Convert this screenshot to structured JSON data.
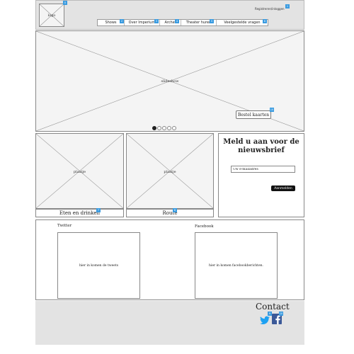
{
  "header": {
    "logo_label": "logo",
    "register_login": "Registreren/inloggen",
    "nav": [
      {
        "label": "Shows",
        "badge": "2"
      },
      {
        "label": "Over Imperium",
        "badge": "3"
      },
      {
        "label": "Archef",
        "badge": "4"
      },
      {
        "label": "Theater huren",
        "badge": "5"
      },
      {
        "label": "Veelgestelde vragen",
        "badge": "6"
      }
    ],
    "logo_badge": "0",
    "register_badge": "1"
  },
  "slideshow": {
    "label": "slideshow",
    "order_button": "Bestel kaarten",
    "order_badge": "10",
    "dots": 5,
    "active_dot": 0
  },
  "cards": [
    {
      "placeholder": "plaatje",
      "caption": "Eten en drinken",
      "badge": "7"
    },
    {
      "placeholder": "plaatje",
      "caption": "Route",
      "badge": "8"
    }
  ],
  "newsletter": {
    "title": "Meld u aan voor de nieuwsbrief",
    "email_placeholder": "Uw e-mailadres",
    "subscribe_button": "Aanmelden"
  },
  "social": {
    "twitter_title": "Twitter",
    "twitter_body": "hier in komen de tweets",
    "facebook_title": "Facebook",
    "facebook_body": "hier in komen facebookberichten."
  },
  "footer": {
    "contact_title": "Contact",
    "twitter_badge": "9",
    "facebook_badge": "10"
  },
  "colors": {
    "badge": "#3a9be0",
    "twitter": "#1da1f2",
    "facebook": "#3b5998"
  }
}
